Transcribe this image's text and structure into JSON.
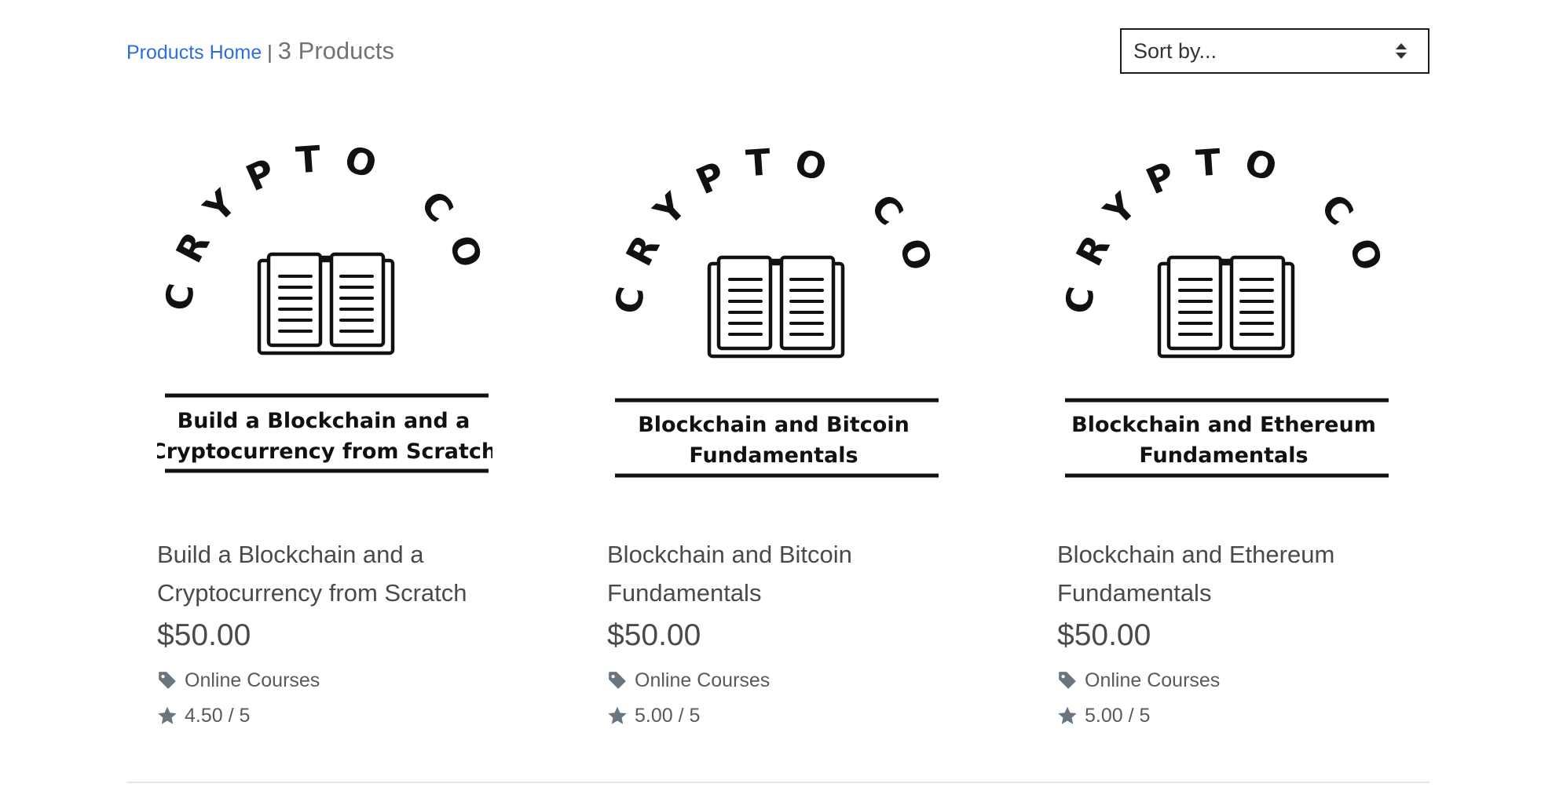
{
  "breadcrumb": {
    "home_label": "Products Home",
    "separator": "|",
    "count_label": "3 Products"
  },
  "sort": {
    "placeholder": "Sort by..."
  },
  "products": [
    {
      "image_arc_text": "CRYPTO COURSE",
      "image_caption_line1": "Build a Blockchain and a",
      "image_caption_line2": "Cryptocurrency from Scratch",
      "title": "Build a Blockchain and a Cryptocurrency from Scratch",
      "price": "$50.00",
      "category": "Online Courses",
      "rating": "4.50 / 5"
    },
    {
      "image_arc_text": "CRYPTO COURSE",
      "image_caption_line1": "Blockchain and Bitcoin",
      "image_caption_line2": "Fundamentals",
      "title": "Blockchain and Bitcoin Fundamentals",
      "price": "$50.00",
      "category": "Online Courses",
      "rating": "5.00 / 5"
    },
    {
      "image_arc_text": "CRYPTO COURSE",
      "image_caption_line1": "Blockchain and Ethereum",
      "image_caption_line2": "Fundamentals",
      "title": "Blockchain and Ethereum Fundamentals",
      "price": "$50.00",
      "category": "Online Courses",
      "rating": "5.00 / 5"
    }
  ],
  "icons": {
    "category": "tag-icon",
    "rating": "star-icon",
    "sort": "sort-arrows-icon",
    "course_logo": "open-book-icon"
  },
  "colors": {
    "link": "#2d6fd6",
    "text": "#4a4a4a",
    "icon": "#6b7580"
  }
}
